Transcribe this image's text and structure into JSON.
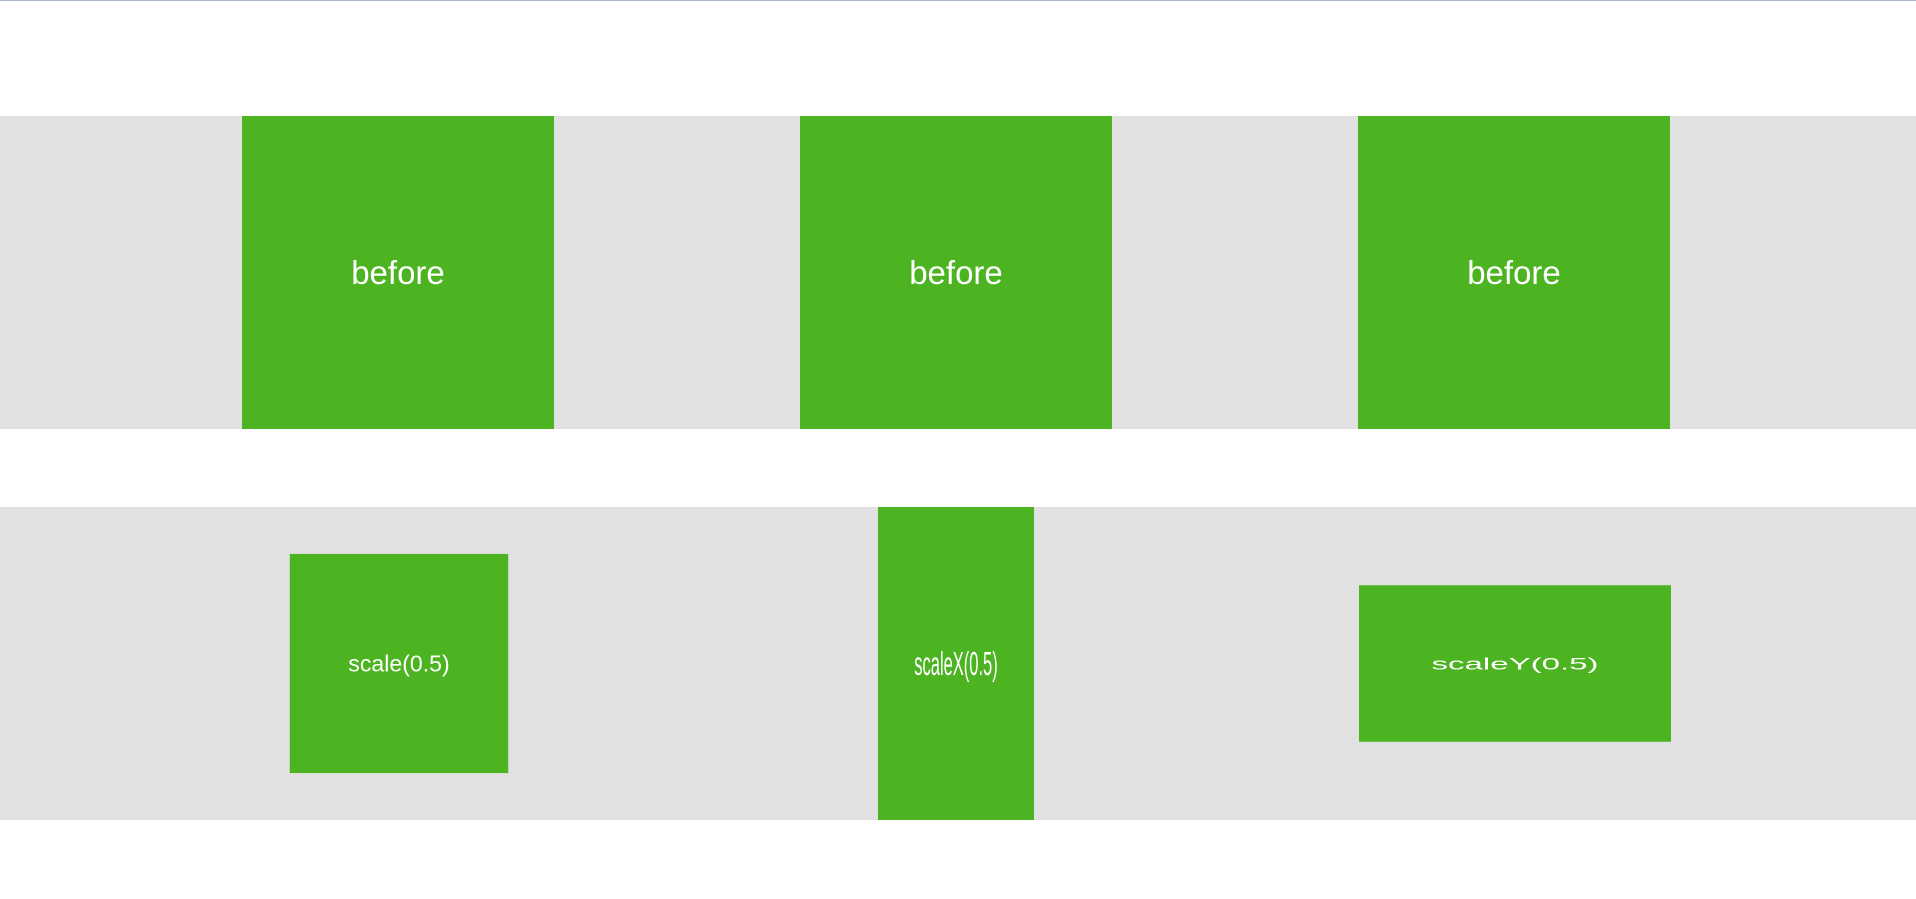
{
  "colors": {
    "page_background": "#ffffff",
    "band_background": "#e1e1e1",
    "box_fill": "#4cb321",
    "box_text": "#ffffff"
  },
  "top_row": {
    "boxes": [
      {
        "label": "before"
      },
      {
        "label": "before"
      },
      {
        "label": "before"
      }
    ]
  },
  "bottom_row": {
    "boxes": [
      {
        "label": "scale(0.5)"
      },
      {
        "label": "scaleX(0.5)"
      },
      {
        "label": "scaleY(0.5)"
      }
    ]
  }
}
